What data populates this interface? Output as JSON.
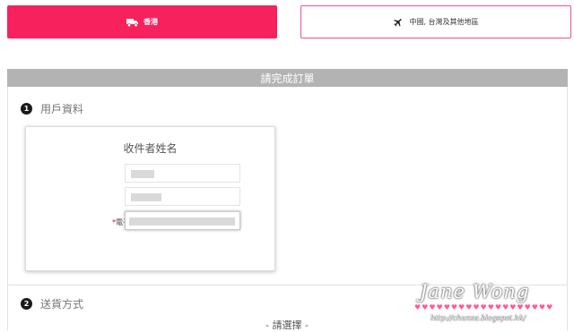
{
  "shipping_tabs": {
    "hk": {
      "label": "香港",
      "icon": "truck-icon",
      "selected": true
    },
    "intl": {
      "label": "中國, 台灣及其他地區",
      "icon": "airplane-icon",
      "selected": false
    }
  },
  "order_section": {
    "title": "請完成訂單"
  },
  "steps": [
    {
      "number": "1",
      "title": "用戶資料"
    },
    {
      "number": "2",
      "title": "送貨方式"
    }
  ],
  "recipient_card": {
    "title": "收件者姓名",
    "required_mark": "*",
    "fields": [
      {
        "label": "姓名"
      },
      {
        "label": "姓氏"
      },
      {
        "label": "電子信箱"
      }
    ]
  },
  "delivery": {
    "select_placeholder": "- 請選擇 -"
  },
  "watermark": {
    "name": "Jane Wong",
    "url": "http://chunza.blogspot.hk/",
    "hearts": "♥♥♥♥♥♥♥♥♥♥♥♥♥♥♥♥♥♥♥"
  },
  "colors": {
    "accent": "#f7215e",
    "section_bar": "#b3b3b3"
  }
}
